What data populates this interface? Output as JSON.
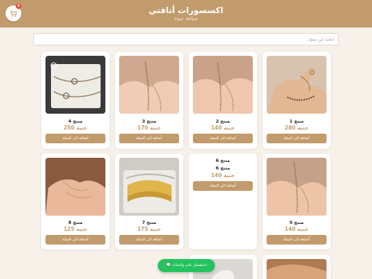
{
  "header": {
    "title": "اكسسورات أناقتي",
    "subtitle": "شياكتك عنوانا",
    "cart_count": "0",
    "cart_icon": "cart-icon"
  },
  "search": {
    "placeholder": "ابحث عن منتج..."
  },
  "products": [
    {
      "name": "منتج 1",
      "price": "280 جنيه",
      "button": "أضافة الى السلة"
    },
    {
      "name": "منتج 2",
      "price": "140 جنيه",
      "button": "أضافة الى السلة"
    },
    {
      "name": "منتج 3",
      "price": "170 جنيه",
      "button": "أضافة الى السلة"
    },
    {
      "name": "منتج 4",
      "price": "250 جنيه",
      "button": "أضافة الى السلة"
    },
    {
      "name": "منتج 5",
      "price": "140 جنيه",
      "button": "أضافة الى السلة"
    },
    {
      "name": "منتج 6",
      "alt_text": "منتج 6",
      "price": "140 جنيه",
      "button": "أضافة الى السلة"
    },
    {
      "name": "منتج 7",
      "price": "175 جنيه",
      "button": "أضافة الى السلة"
    },
    {
      "name": "منتج 8",
      "price": "125 جنيه",
      "button": "أضافة الى السلة"
    }
  ],
  "whatsapp": {
    "label": "استفسار على واتساب",
    "icon": "chat-icon"
  },
  "colors": {
    "brand": "#c29b6c",
    "background": "#f7f1ea",
    "whatsapp": "#25c35f",
    "badge": "#e8423a"
  }
}
